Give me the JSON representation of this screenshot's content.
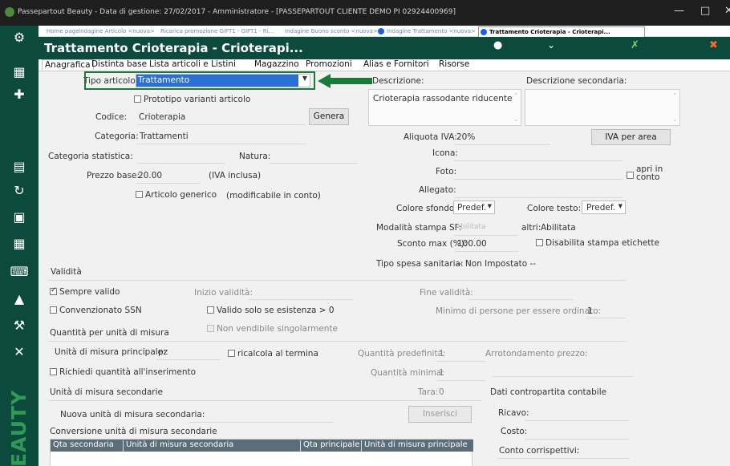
{
  "window": {
    "title": "Passepartout Beauty - Data di gestione: 27/02/2017 - Amministratore - [PASSEPARTOUT CLIENTE DEMO PI 02924400969]",
    "minimize": "—",
    "maximize": "□",
    "close": "✕"
  },
  "sidebar": {
    "brand": "BEAUTY"
  },
  "doc_tabs": [
    "Home page",
    "Indagine Articolo <nuova>",
    "Ricarica promozione GIFT1 - GIFT1 - Ri...",
    "Indagine Buono sconto <nuova>",
    "Indagine Trattamento <nuova>",
    "Trattamento Crioterapia - Crioterapi..."
  ],
  "header": {
    "title": "Trattamento Crioterapia - Crioterapi..."
  },
  "subtabs": [
    "Anagrafica",
    "Distinta base",
    "Lista articoli e Listini",
    "Magazzino",
    "Promozioni",
    "Alias e Fornitori",
    "Risorse"
  ],
  "form": {
    "tipo_articolo_label": "Tipo articolo:",
    "tipo_articolo_value": "Trattamento",
    "prototipo_label": "Prototipo varianti articolo",
    "codice_label": "Codice:",
    "codice_value": "Crioterapia",
    "genera_button": "Genera",
    "categoria_label": "Categoria:",
    "categoria_value": "Trattamenti",
    "categoria_statistica_label": "Categoria statistica:",
    "natura_label": "Natura:",
    "prezzo_base_label": "Prezzo base:",
    "prezzo_base_value": "20.00",
    "iva_inclusa": "(IVA inclusa)",
    "articolo_generico_label": "Articolo generico",
    "modificabile_label": "(modificabile in conto)",
    "descrizione_label": "Descrizione:",
    "descrizione_value": "Crioterapia rassodante riducente",
    "descrizione_secondaria_label": "Descrizione secondaria:",
    "aliquota_label": "Aliquota IVA:",
    "aliquota_value": "20%",
    "iva_per_area_button": "IVA per area",
    "icona_label": "Icona:",
    "foto_label": "Foto:",
    "apri_in_conto_label": "apri in conto",
    "allegato_label": "Allegato:",
    "colore_sfondo_label": "Colore sfondo:",
    "colore_sfondo_value": "Predef.",
    "colore_testo_label": "Colore testo:",
    "colore_testo_value": "Predef.",
    "modalita_stampa_label": "Modalità stampa SF:",
    "modalita_stampa_value": "Abilitata",
    "altri_label": "altri:",
    "altri_value": "Abilitata",
    "sconto_max_label": "Sconto max (%):",
    "sconto_max_value": "100.00",
    "disabilita_stampa_label": "Disabilita stampa etichette",
    "tipo_spesa_label": "Tipo spesa sanitaria:",
    "tipo_spesa_value": "-- Non Impostato --",
    "validita_heading": "Validità",
    "sempre_valido_label": "Sempre valido",
    "inizio_validita_label": "Inizio validità:",
    "fine_validita_label": "Fine validità:",
    "convenzionato_label": "Convenzionato SSN",
    "valido_esistenza_label": "Valido solo se esistenza > 0",
    "minimo_persone_label": "Minimo di persone per essere ordinato:",
    "minimo_persone_value": "1",
    "non_vendibile_label": "Non vendibile singolarmente",
    "quantita_heading": "Quantità per unità di misura",
    "unita_principale_label": "Unità di misura principale:",
    "unita_principale_value": "pz",
    "ricalcola_label": "ricalcola al termina",
    "quantita_predefinita_label": "Quantità predefinita:",
    "quantita_predefinita_value": "1",
    "arrotondamento_label": "Arrotondamento prezzo:",
    "richiedi_label": "Richiedi quantità all'inserimento",
    "quantita_minima_label": "Quantità minima:",
    "quantita_minima_value": "1",
    "unita_secondarie_heading": "Unità di misura secondarie",
    "tara_label": "Tara:",
    "tara_value": "0",
    "dati_contropartita_heading": "Dati contropartita contabile",
    "nuova_unita_label": "Nuova unità di misura secondaria:",
    "inserisci_button": "Inserisci",
    "ricavo_label": "Ricavo:",
    "conversione_heading": "Conversione unità di misura secondarie",
    "costo_label": "Costo:",
    "conto_corrispettivi_label": "Conto corrispettivi:",
    "table_columns": [
      "Qta secondaria",
      "Unità di misura secondaria",
      "Qta principale",
      "Unità di misura principale"
    ]
  },
  "colors": {
    "sidebar": "#0b4a3c",
    "highlight_box": "#1a7a3a",
    "arrow": "#1a7a3a",
    "select_highlight": "#2a6fd6"
  }
}
